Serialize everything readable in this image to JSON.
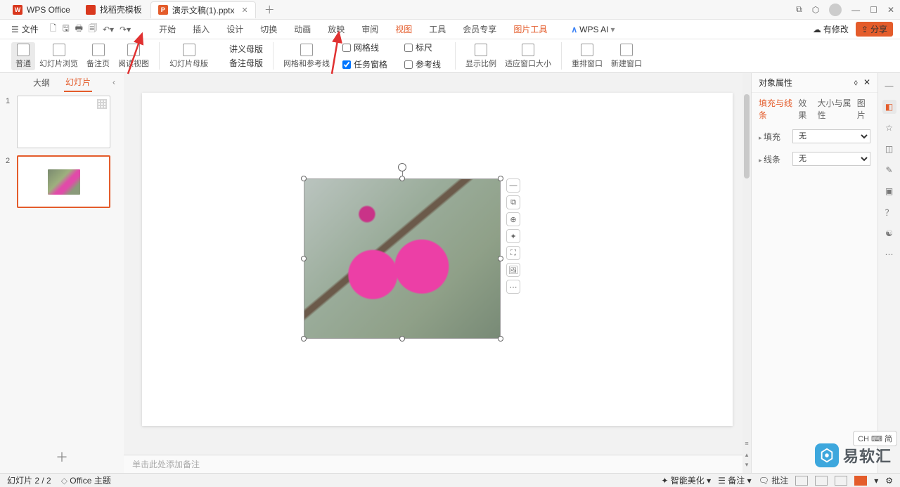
{
  "titlebar": {
    "app": "WPS Office",
    "tab1": "找稻壳模板",
    "tab2": "演示文稿(1).pptx"
  },
  "menu": {
    "file": "文件",
    "tabs": [
      "开始",
      "插入",
      "设计",
      "切换",
      "动画",
      "放映",
      "审阅",
      "视图",
      "工具",
      "会员专享",
      "图片工具"
    ],
    "active": "视图",
    "ai": "WPS AI",
    "changes": "有修改",
    "share": "分享"
  },
  "ribbon": {
    "g1": {
      "normal": "普通",
      "browse": "幻灯片浏览",
      "notes": "备注页",
      "read": "阅读视图"
    },
    "g2": {
      "slideMaster": "幻灯片母版",
      "handoutMaster": "讲义母版",
      "notesMaster": "备注母版"
    },
    "g3": {
      "guides": "网格和参考线",
      "grid": "网格线",
      "ruler": "标尺",
      "taskpane": "任务窗格",
      "refline": "参考线"
    },
    "g4": {
      "zoom": "显示比例",
      "fit": "适应窗口大小"
    },
    "g5": {
      "arrange": "重排窗口",
      "newwin": "新建窗口"
    }
  },
  "leftpanel": {
    "outline": "大纲",
    "slides": "幻灯片"
  },
  "notes": {
    "placeholder": "单击此处添加备注"
  },
  "rightpanel": {
    "title": "对象属性",
    "tabs": [
      "填充与线条",
      "效果",
      "大小与属性",
      "图片"
    ],
    "fill": "填充",
    "fillVal": "无",
    "line": "线条",
    "lineVal": "无"
  },
  "status": {
    "page": "幻灯片 2 / 2",
    "theme": "Office 主题",
    "beautify": "智能美化",
    "notes": "备注",
    "comments": "批注"
  },
  "lang": "CH ⌨ 简",
  "watermark": "易软汇"
}
